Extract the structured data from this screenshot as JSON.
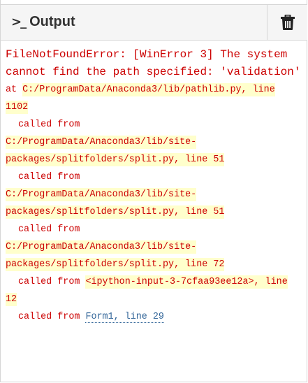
{
  "header": {
    "title": "Output",
    "prompt_icon": ">_",
    "clear_icon": "trash-icon"
  },
  "error": {
    "message": "FileNotFoundError: [WinError 3] The system cannot find the path specified: 'validation'"
  },
  "traceback": {
    "at_label": "at",
    "at_location": "C:/ProgramData/Anaconda3/lib/pathlib.py, line 1102",
    "frames": [
      {
        "called_label": "called from",
        "location": "C:/ProgramData/Anaconda3/lib/site-packages/splitfolders/split.py, line 51"
      },
      {
        "called_label": "called from",
        "location": "C:/ProgramData/Anaconda3/lib/site-packages/splitfolders/split.py, line 51"
      },
      {
        "called_label": "called from",
        "location": "C:/ProgramData/Anaconda3/lib/site-packages/splitfolders/split.py, line 72"
      },
      {
        "called_label": "called from",
        "location": "<ipython-input-3-7cfaa93ee12a>, line 12"
      },
      {
        "called_label": "called from",
        "location": "Form1, line 29"
      }
    ]
  },
  "colors": {
    "error_text": "#cc0000",
    "highlight_bg": "#ffffcc",
    "link": "#336699"
  }
}
